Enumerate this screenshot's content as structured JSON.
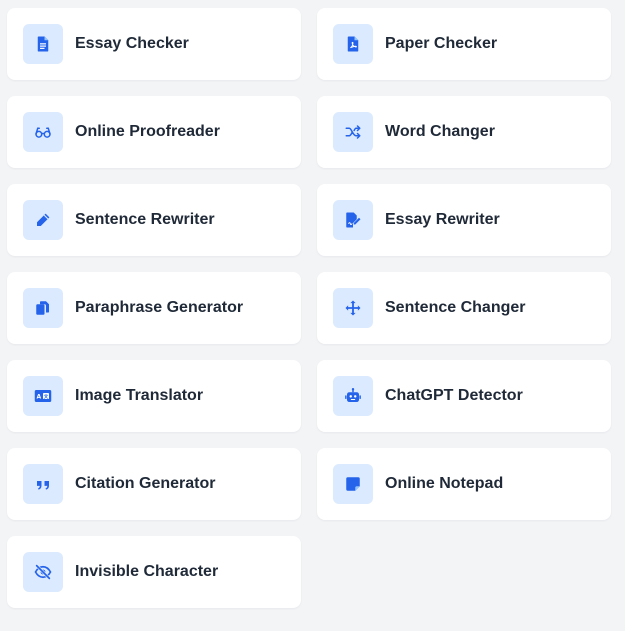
{
  "accent_color": "#2563eb",
  "icon_bg_color": "#dbeafe",
  "tools": [
    {
      "label": "Essay Checker",
      "icon": "document-icon"
    },
    {
      "label": "Paper Checker",
      "icon": "pdf-file-icon"
    },
    {
      "label": "Online Proofreader",
      "icon": "glasses-icon"
    },
    {
      "label": "Word Changer",
      "icon": "shuffle-icon"
    },
    {
      "label": "Sentence Rewriter",
      "icon": "pencil-icon"
    },
    {
      "label": "Essay Rewriter",
      "icon": "file-signature-icon"
    },
    {
      "label": "Paraphrase Generator",
      "icon": "copy-icon"
    },
    {
      "label": "Sentence Changer",
      "icon": "move-arrows-icon"
    },
    {
      "label": "Image Translator",
      "icon": "language-card-icon"
    },
    {
      "label": "ChatGPT Detector",
      "icon": "robot-icon"
    },
    {
      "label": "Citation Generator",
      "icon": "quote-icon"
    },
    {
      "label": "Online Notepad",
      "icon": "sticky-note-icon"
    },
    {
      "label": "Invisible Character",
      "icon": "eye-slash-icon"
    }
  ]
}
